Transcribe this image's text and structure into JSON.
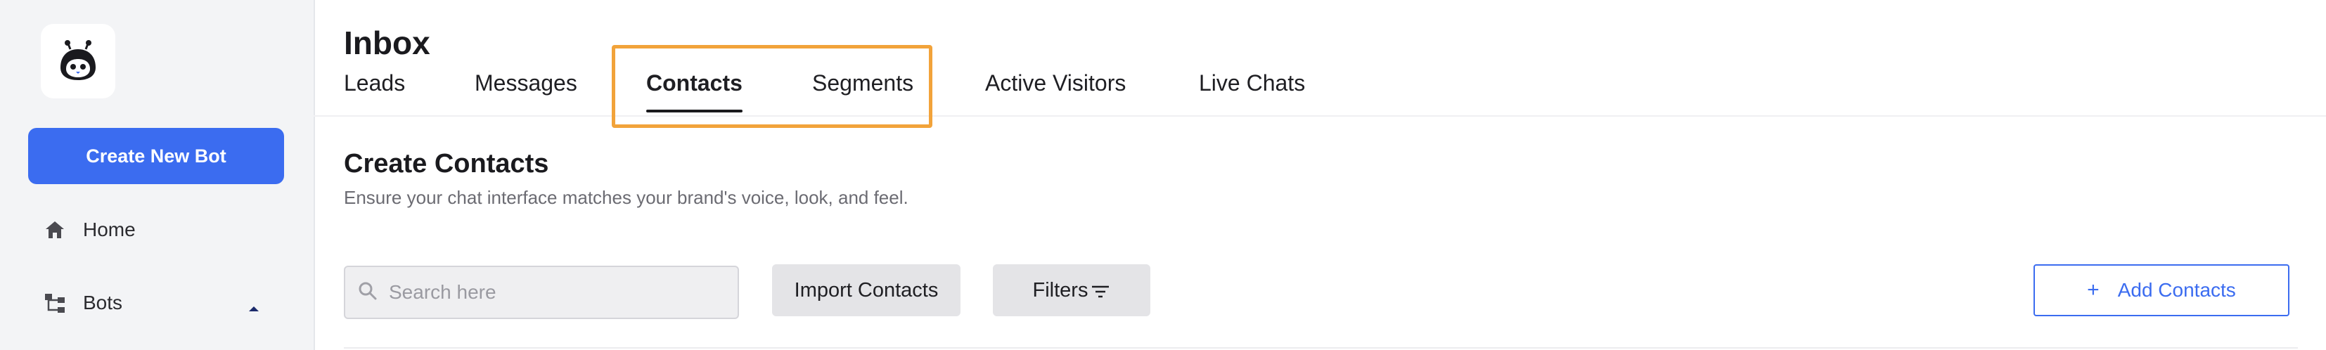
{
  "sidebar": {
    "logo_icon": "bot-logo-icon",
    "create_bot_label": "Create New Bot",
    "items": [
      {
        "label": "Home",
        "icon": "home-icon"
      },
      {
        "label": "Bots",
        "icon": "bots-tree-icon",
        "expanded": true
      }
    ]
  },
  "header": {
    "title": "Inbox",
    "tabs": [
      {
        "label": "Leads"
      },
      {
        "label": "Messages"
      },
      {
        "label": "Contacts",
        "active": true
      },
      {
        "label": "Segments"
      },
      {
        "label": "Active Visitors"
      },
      {
        "label": "Live Chats"
      }
    ]
  },
  "section": {
    "title": "Create Contacts",
    "subtitle": "Ensure your chat interface matches your brand's voice, look, and feel."
  },
  "toolbar": {
    "search_placeholder": "Search here",
    "import_label": "Import Contacts",
    "filters_label": "Filters",
    "add_label": "Add Contacts",
    "add_icon": "+"
  },
  "colors": {
    "accent": "#3b6cf0",
    "highlight": "#f2a33a",
    "sidebar_bg": "#f3f4f6"
  }
}
